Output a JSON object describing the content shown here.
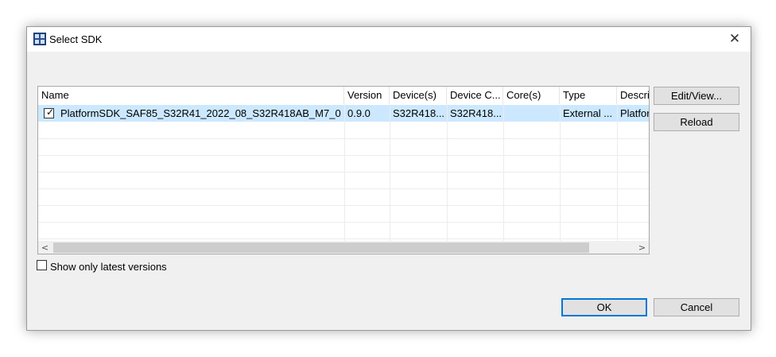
{
  "window": {
    "title": "Select SDK",
    "close_glyph": "✕"
  },
  "table": {
    "columns": [
      "Name",
      "Version",
      "Device(s)",
      "Device C...",
      "Core(s)",
      "Type",
      "Descrip"
    ],
    "rows": [
      {
        "checked": true,
        "name": "PlatformSDK_SAF85_S32R41_2022_08_S32R418AB_M7_0",
        "version": "0.9.0",
        "devices": "S32R418...",
        "device_c": "S32R418...",
        "cores": "",
        "type": "External ...",
        "description": "Platfor"
      }
    ],
    "scroll_left": "<",
    "scroll_right": ">"
  },
  "buttons": {
    "edit_view": "Edit/View...",
    "reload": "Reload",
    "ok": "OK",
    "cancel": "Cancel"
  },
  "options": {
    "show_latest_label": "Show only latest versions",
    "show_latest_checked": false
  },
  "icons": {
    "app": "sdk-app-icon",
    "close": "close-icon",
    "check": "checkmark-icon"
  },
  "colors": {
    "selection": "#cce8ff",
    "default_button_border": "#0078d7"
  }
}
